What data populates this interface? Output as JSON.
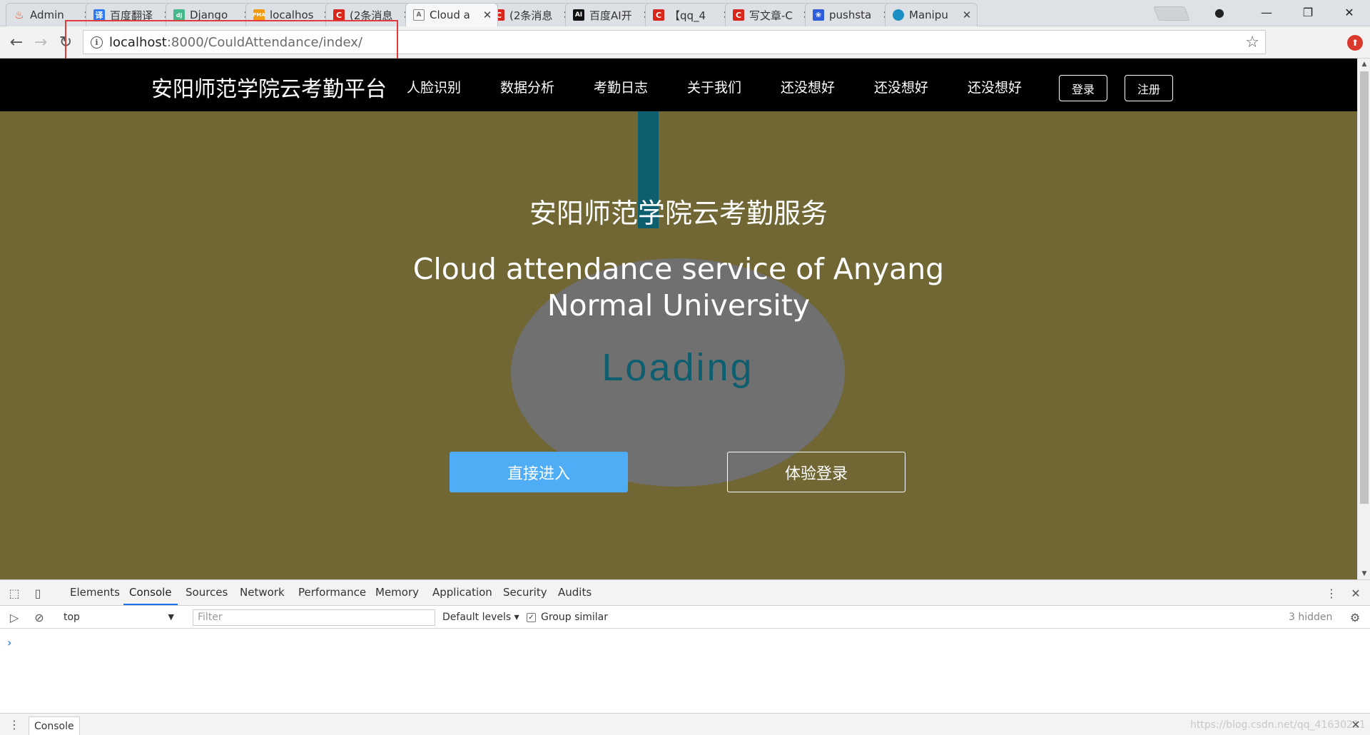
{
  "browser": {
    "tabs": [
      {
        "title": "Admin",
        "favicon": "flame-icon",
        "color": "#e34c26"
      },
      {
        "title": "百度翻译",
        "favicon": "translate-icon",
        "color": "#2b7cf3"
      },
      {
        "title": "Django",
        "favicon": "django-icon",
        "color": "#44b78b"
      },
      {
        "title": "localhos",
        "favicon": "pma-icon",
        "color": "#f39c12"
      },
      {
        "title": "(2条消息",
        "favicon": "csdn-icon",
        "color": "#d9261c"
      },
      {
        "title": "Cloud a",
        "favicon": "page-icon",
        "color": "#888888"
      },
      {
        "title": "(2条消息",
        "favicon": "csdn-icon",
        "color": "#d9261c"
      },
      {
        "title": "百度AI开",
        "favicon": "ai-icon",
        "color": "#111111"
      },
      {
        "title": "【qq_4",
        "favicon": "csdn-icon",
        "color": "#d9261c"
      },
      {
        "title": "写文章-C",
        "favicon": "csdn-icon",
        "color": "#d9261c"
      },
      {
        "title": "pushsta",
        "favicon": "baidu-icon",
        "color": "#2e5ddb"
      },
      {
        "title": "Manipu",
        "favicon": "bird-icon",
        "color": "#1b8fc4"
      }
    ],
    "active_tab_index": 5,
    "address": {
      "host": "localhost",
      "path": ":8000/CouldAttendance/index/"
    }
  },
  "site": {
    "brand": "安阳师范学院云考勤平台",
    "menu": [
      "人脸识别",
      "数据分析",
      "考勤日志",
      "关于我们",
      "还没想好",
      "还没想好",
      "还没想好"
    ],
    "login": "登录",
    "register": "注册"
  },
  "hero": {
    "title_cn": "安阳师范学院云考勤服务",
    "title_en": "Cloud attendance service of Anyang Normal University",
    "loading": "Loading",
    "enter_button": "直接进入",
    "trial_login_button": "体验登录"
  },
  "devtools": {
    "tabs": [
      "Elements",
      "Console",
      "Sources",
      "Network",
      "Performance",
      "Memory",
      "Application",
      "Security",
      "Audits"
    ],
    "active_tab": "Console",
    "context": "top",
    "filter_placeholder": "Filter",
    "levels": "Default levels",
    "group_similar": "Group similar",
    "hidden_count": "3 hidden",
    "prompt": "›",
    "drawer_tab": "Console"
  },
  "watermark": "https://blog.csdn.net/qq_41630211",
  "colors": {
    "page_bg": "#706735",
    "navbar_bg": "#000000",
    "primary_button": "#4fadf5",
    "loading_text": "#0d5e6e",
    "ellipse": "#707070",
    "highlight_box": "#e03a3a"
  }
}
